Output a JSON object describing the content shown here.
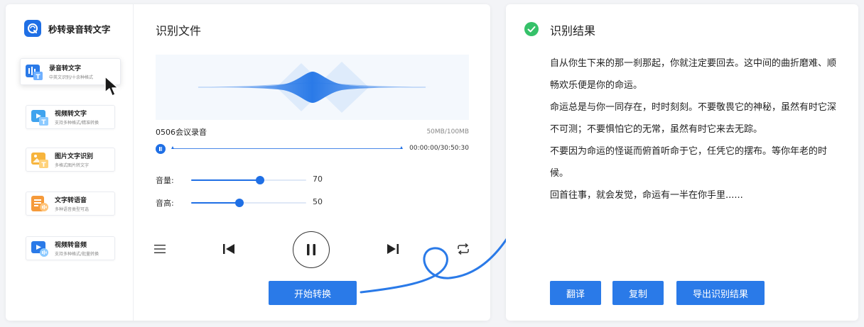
{
  "app": {
    "name": "秒转录音转文字",
    "brand_color": "#1f6fe5",
    "logo_icon": "app-logo-icon"
  },
  "sidebar": {
    "items": [
      {
        "name": "录音转文字",
        "desc": "中英文识别/十余种格式",
        "icon": "mic-text-icon",
        "active": true
      },
      {
        "name": "视频转文字",
        "desc": "支持多种格式/精准转换",
        "icon": "video-text-icon",
        "active": false
      },
      {
        "name": "图片文字识别",
        "desc": "多格式图片转文字",
        "icon": "image-text-icon",
        "active": false
      },
      {
        "name": "文字转语音",
        "desc": "多种语音类型可选",
        "icon": "text-speech-icon",
        "active": false
      },
      {
        "name": "视频转音频",
        "desc": "支持多种格式/批量转换",
        "icon": "video-audio-icon",
        "active": false
      }
    ]
  },
  "player": {
    "title": "识别文件",
    "file_name": "0506会议录音",
    "file_size": "50MB/100MB",
    "time": "00:00:00/30:50:30",
    "progress_fraction": 0.0,
    "volume": {
      "label": "音量:",
      "value": "70",
      "fraction": 0.6
    },
    "pitch": {
      "label": "音高:",
      "value": "50",
      "fraction": 0.42
    },
    "controls": [
      "menu-icon",
      "previous-icon",
      "pause-icon",
      "next-icon",
      "repeat-icon"
    ],
    "start_button": "开始转换"
  },
  "result": {
    "title": "识别结果",
    "status_icon": "check-circle-icon",
    "status_color": "#35c169",
    "paragraphs": [
      "自从你生下来的那一刹那起，你就注定要回去。这中间的曲折磨难、顺畅欢乐便是你的命运。",
      "命运总是与你一同存在，时时刻刻。不要敬畏它的神秘，虽然有时它深不可测；不要惧怕它的无常，虽然有时它来去无踪。",
      "不要因为命运的怪诞而俯首听命于它，任凭它的摆布。等你年老的时候。",
      "回首往事，就会发觉，命运有一半在你手里......"
    ],
    "buttons": {
      "translate": "翻译",
      "copy": "复制",
      "export": "导出识别结果"
    }
  }
}
